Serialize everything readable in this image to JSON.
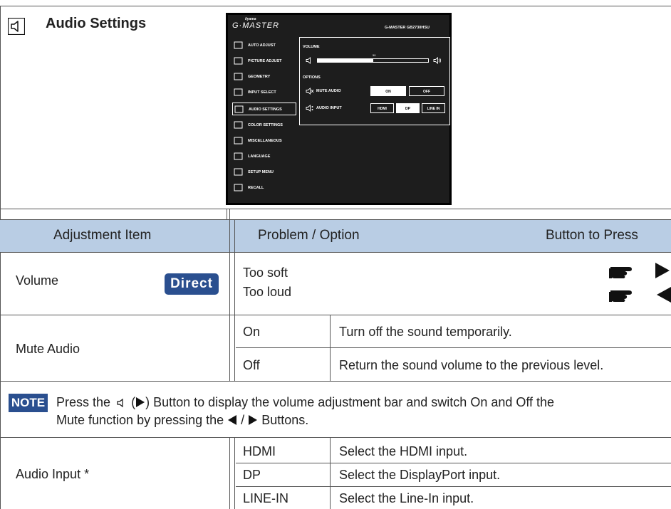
{
  "section": {
    "title": "Audio Settings",
    "icon": "speaker-icon"
  },
  "osd": {
    "brand_small": "iiyama",
    "brand": "G·MASTER",
    "model": "G-MASTER GB2730HSU",
    "menu": [
      {
        "label": "AUTO ADJUST",
        "icon": "auto-adjust-icon"
      },
      {
        "label": "PICTURE ADJUST",
        "icon": "picture-adjust-icon"
      },
      {
        "label": "GEOMETRY",
        "icon": "geometry-icon"
      },
      {
        "label": "INPUT SELECT",
        "icon": "input-select-icon"
      },
      {
        "label": "AUDIO SETTINGS",
        "icon": "audio-settings-icon",
        "selected": true
      },
      {
        "label": "COLOR SETTINGS",
        "icon": "color-settings-icon"
      },
      {
        "label": "MISCELLANEOUS",
        "icon": "miscellaneous-icon"
      },
      {
        "label": "LANGUAGE",
        "icon": "language-icon"
      },
      {
        "label": "SETUP MENU",
        "icon": "setup-menu-icon"
      },
      {
        "label": "RECALL",
        "icon": "recall-icon"
      }
    ],
    "volume_label": "VOLUME",
    "volume_value": "50",
    "volume_level": 0.5,
    "options_label": "OPTIONS",
    "mute_label": "MUTE AUDIO",
    "mute_on": "ON",
    "mute_off": "OFF",
    "audio_input_label": "AUDIO INPUT",
    "audio_inputs": [
      "HDMI",
      "DP",
      "LINE IN"
    ],
    "audio_input_selected": "DP"
  },
  "table": {
    "headers": {
      "item": "Adjustment Item",
      "problem": "Problem / Option",
      "button": "Button to Press"
    },
    "volume": {
      "label": "Volume",
      "badge": "Direct",
      "soft": "Too soft",
      "loud": "Too loud"
    },
    "mute": {
      "label": "Mute Audio",
      "rows": [
        {
          "option": "On",
          "desc": "Turn off the sound temporarily."
        },
        {
          "option": "Off",
          "desc": "Return the sound volume to the previous level."
        }
      ]
    },
    "note": {
      "badge": "NOTE",
      "line1_a": "Press the",
      "line1_b": "(",
      "line1_c": ") Button to display the volume adjustment bar and switch On and Off the",
      "line2_a": "Mute function by pressing the",
      "line2_b": "/",
      "line2_c": "Buttons."
    },
    "audio_input": {
      "label": "Audio Input *",
      "rows": [
        {
          "option": "HDMI",
          "desc": "Select the HDMI input."
        },
        {
          "option": "DP",
          "desc": "Select the DisplayPort input."
        },
        {
          "option": "LINE-IN",
          "desc": "Select the Line-In input."
        }
      ]
    }
  }
}
